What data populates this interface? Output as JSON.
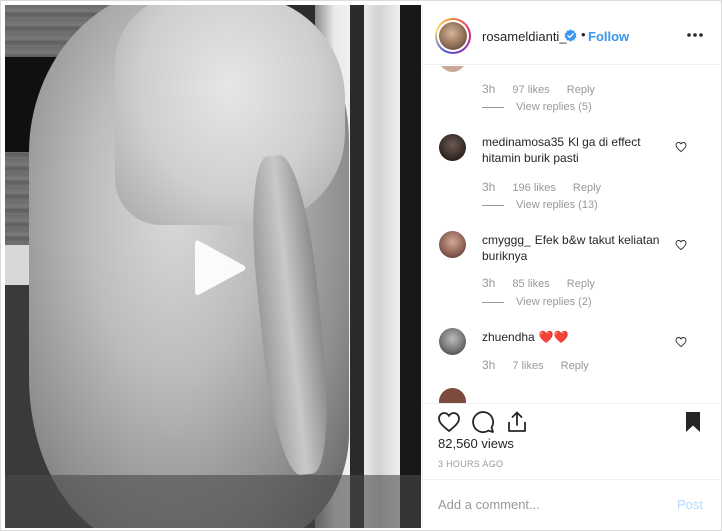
{
  "post": {
    "username": "rosameldianti_",
    "verified": true,
    "separator": "•",
    "follow_label": "Follow",
    "more_icon": "more-options-icon"
  },
  "media": {
    "type": "video",
    "play_icon": "play-icon"
  },
  "comments": [
    {
      "username": "",
      "text": "",
      "time": "3h",
      "likes": "97 likes",
      "reply_label": "Reply",
      "view_replies": "View replies (5)"
    },
    {
      "username": "medinamosa35",
      "text": "Kl ga di effect hitamin burik pasti",
      "time": "3h",
      "likes": "196 likes",
      "reply_label": "Reply",
      "view_replies": "View replies (13)"
    },
    {
      "username": "cmyggg_",
      "text": "Efek b&w takut keliatan buriknya",
      "time": "3h",
      "likes": "85 likes",
      "reply_label": "Reply",
      "view_replies": "View replies (2)"
    },
    {
      "username": "zhuendha",
      "text": "❤️❤️",
      "time": "3h",
      "likes": "7 likes",
      "reply_label": "Reply",
      "view_replies": ""
    }
  ],
  "actions": {
    "like_icon": "heart-icon",
    "comment_icon": "comment-icon",
    "share_icon": "share-icon",
    "save_icon": "bookmark-icon"
  },
  "stats": {
    "views": "82,560 views",
    "age": "3 HOURS AGO"
  },
  "composer": {
    "placeholder": "Add a comment...",
    "post_label": "Post"
  },
  "colors": {
    "link_blue": "#3897f0",
    "post_disabled": "#b3dbff",
    "muted_text": "#999999",
    "heart_red": "#ed4956"
  }
}
